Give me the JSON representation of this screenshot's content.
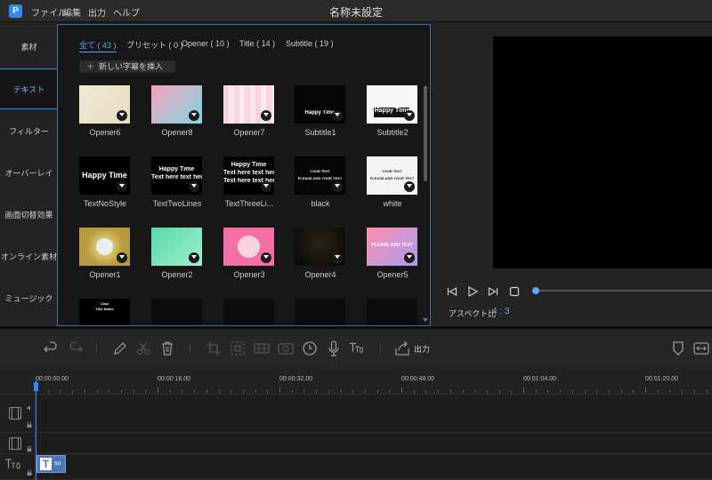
{
  "titlebar": {
    "logo": "P",
    "menu": [
      "ファイル",
      "編集",
      "出力",
      "ヘルプ"
    ],
    "title": "名称未設定"
  },
  "sidebar": {
    "items": [
      {
        "label": "素材"
      },
      {
        "label": "テキスト",
        "active": true
      },
      {
        "label": "フィルター"
      },
      {
        "label": "オーバーレイ"
      },
      {
        "label": "画面切替効果"
      },
      {
        "label": "オンライン素材"
      },
      {
        "label": "ミュージック"
      }
    ]
  },
  "media": {
    "tabs": [
      {
        "label": "全て ( 43 )",
        "active": true
      },
      {
        "label": "プリセット ( 0 )"
      },
      {
        "label": "Opener ( 10 )"
      },
      {
        "label": "Title ( 14 )"
      },
      {
        "label": "Subtitle ( 19 )"
      }
    ],
    "add_button": "新しい字幕を挿入",
    "items": [
      {
        "label": "Opener6",
        "style": "opener6",
        "text": "",
        "download": true
      },
      {
        "label": "Opener8",
        "style": "opener8",
        "text": "",
        "download": true
      },
      {
        "label": "Opener7",
        "style": "opener7",
        "text": "",
        "download": true
      },
      {
        "label": "Subtitle1",
        "style": "subtitle1",
        "text": "Happy Time",
        "download": true
      },
      {
        "label": "Subtitle2",
        "style": "subtitle2",
        "text": "Happy Time",
        "download": true
      },
      {
        "label": "TextNoStyle",
        "style": "nostyle",
        "text": "Happy Time",
        "download": true
      },
      {
        "label": "TextTwoLines",
        "style": "twolines",
        "text": "Happy Time",
        "text2": "Text here text here",
        "download": true
      },
      {
        "label": "TextThreeLi...",
        "style": "threelines",
        "text": "Happy Time",
        "text2": "Text here text here",
        "text3": "Text here text here",
        "download": true
      },
      {
        "label": "black",
        "style": "black",
        "text": "YOUR TEXT",
        "text2": "PLEASE ADD YOUR TEXT",
        "download": true
      },
      {
        "label": "white",
        "style": "white",
        "text": "YOUR TEXT",
        "text2": "PLEASE ADD YOUR TEXT",
        "download": true
      },
      {
        "label": "Opener1",
        "style": "opener1",
        "text": "",
        "download": true
      },
      {
        "label": "Opener2",
        "style": "opener2",
        "text": "",
        "download": true
      },
      {
        "label": "Opener3",
        "style": "opener3",
        "text": "",
        "download": true
      },
      {
        "label": "Opener4",
        "style": "opener4",
        "text": "",
        "download": true
      },
      {
        "label": "Opener5",
        "style": "opener5",
        "text": "PLEASE ADD TEXT",
        "download": true
      },
      {
        "label": "",
        "style": "credits",
        "text": "Cast",
        "text2": "Title Name",
        "download": false
      },
      {
        "label": "",
        "style": "dark",
        "text": "",
        "download": false
      },
      {
        "label": "",
        "style": "dark",
        "text": "",
        "download": false
      },
      {
        "label": "",
        "style": "dark",
        "text": "",
        "download": false
      },
      {
        "label": "",
        "style": "dark",
        "text": "",
        "download": false
      }
    ]
  },
  "preview": {
    "aspect_label": "アスペクト比",
    "aspect_value": "4 : 3",
    "progress": 0
  },
  "toolbar": {
    "export_label": "出力"
  },
  "timeline": {
    "ticks": [
      "00:00:00.00",
      "00:00:16.00",
      "00:00:32.00",
      "00:00:48.00",
      "00:01:04.00",
      "00:01:20.00"
    ],
    "subtitle_clip_label": "su"
  },
  "colors": {
    "accent": "#2d8cf0",
    "accent_light": "#5aa7f2",
    "clip": "#4f74b8"
  }
}
